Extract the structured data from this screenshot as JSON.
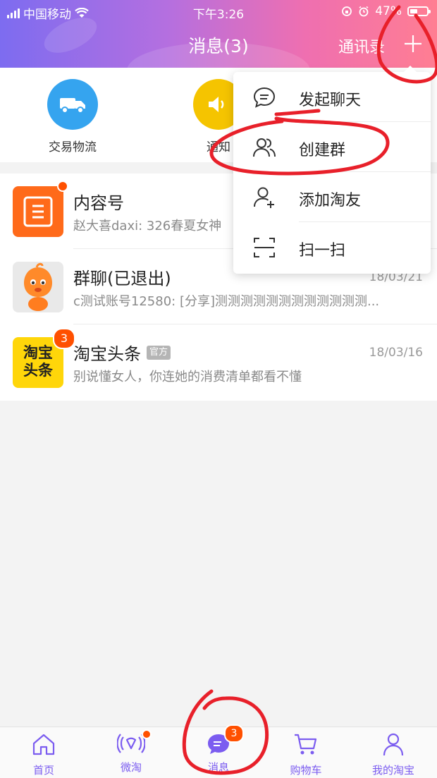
{
  "status_bar": {
    "carrier": "中国移动",
    "time": "下午3:26",
    "battery": "47%"
  },
  "header": {
    "title": "消息(3)",
    "contacts": "通讯录"
  },
  "quick_actions": [
    {
      "label": "交易物流"
    },
    {
      "label": "通知"
    }
  ],
  "conversations": [
    {
      "name": "内容号",
      "message": "赵大喜daxi: 326春夏女神",
      "date": "",
      "unread_dot": true
    },
    {
      "name": "群聊(已退出)",
      "message": "c测试账号12580: [分享]测测测测测测测测测测测测...",
      "date": "18/03/21"
    },
    {
      "name": "淘宝头条",
      "tag": "官方",
      "message": "别说懂女人，你连她的消费清单都看不懂",
      "date": "18/03/16",
      "badge": "3",
      "avatar_text_1": "淘宝",
      "avatar_text_2": "头条"
    }
  ],
  "menu": {
    "items": [
      {
        "label": "发起聊天",
        "icon": "chat-bubble-icon"
      },
      {
        "label": "创建群",
        "icon": "group-icon"
      },
      {
        "label": "添加淘友",
        "icon": "add-friend-icon"
      },
      {
        "label": "扫一扫",
        "icon": "scan-icon"
      }
    ]
  },
  "tabbar": {
    "items": [
      {
        "label": "首页"
      },
      {
        "label": "微淘"
      },
      {
        "label": "消息",
        "badge": "3"
      },
      {
        "label": "购物车"
      },
      {
        "label": "我的淘宝"
      }
    ]
  },
  "colors": {
    "accent": "#7b5cf0",
    "badge": "#ff5000",
    "annotation": "#e8202a"
  }
}
